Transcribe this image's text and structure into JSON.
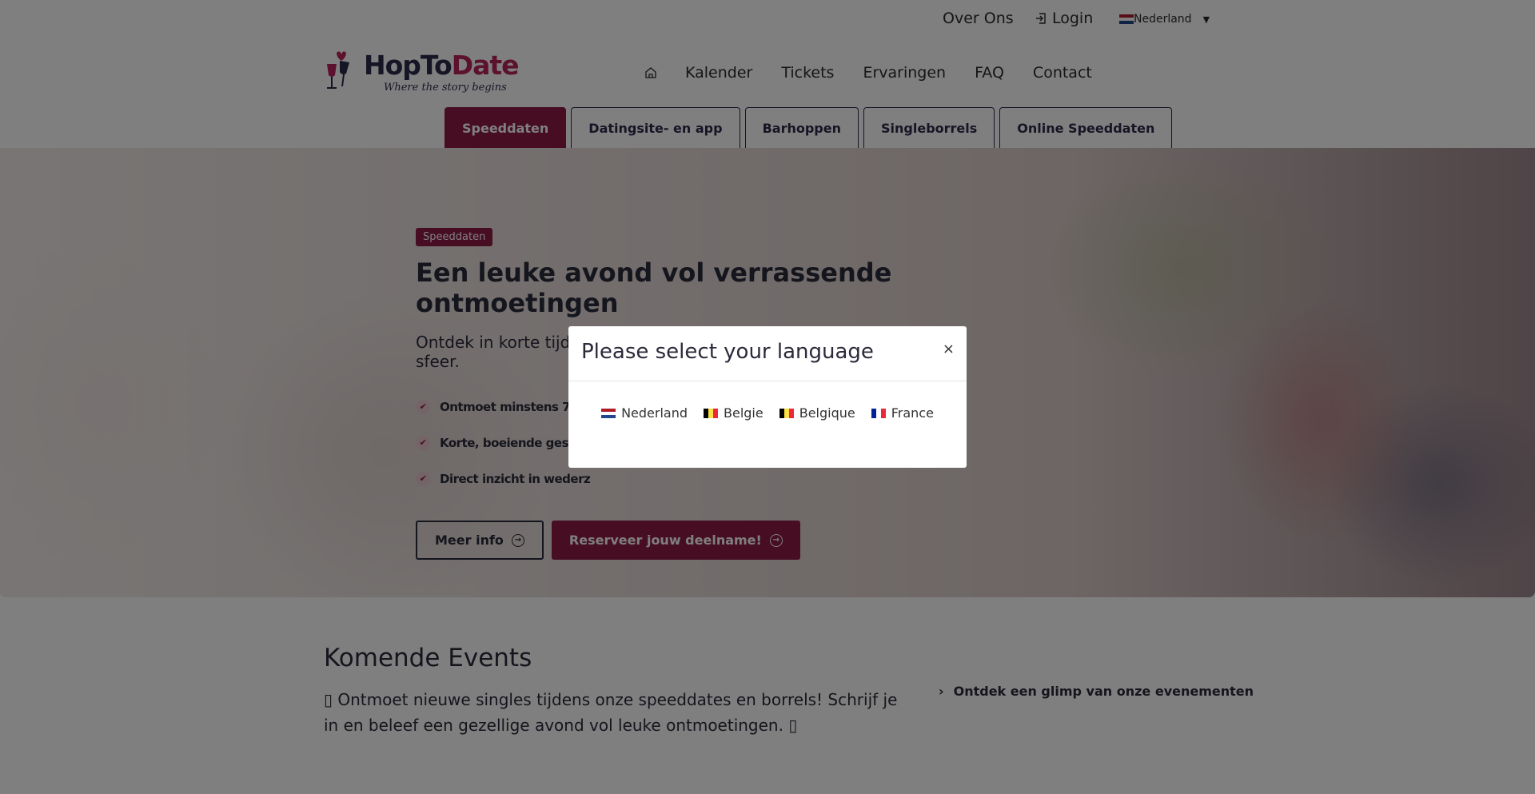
{
  "topbar": {
    "over_ons": "Over Ons",
    "login": "Login",
    "language": "Nederland"
  },
  "logo": {
    "brand_a": "HopTo",
    "brand_b": "Date",
    "tagline": "Where the story begins"
  },
  "nav": {
    "items": [
      "Kalender",
      "Tickets",
      "Ervaringen",
      "FAQ",
      "Contact"
    ]
  },
  "tabs": [
    "Speeddaten",
    "Datingsite- en app",
    "Barhoppen",
    "Singleborrels",
    "Online Speeddaten"
  ],
  "hero": {
    "badge": "Speeddaten",
    "title": "Een leuke avond vol verrassende ontmoetingen",
    "subtitle": "Ontdek in korte tijd wie bij jou past, in een ontspannen en gezellige sfeer.",
    "features": [
      "Ontmoet minstens 7 sin",
      "Korte, boeiende gespre",
      "Direct inzicht in wederz"
    ],
    "btn_info": "Meer info",
    "btn_reserve": "Reserveer jouw deelname!"
  },
  "events": {
    "title": "Komende Events",
    "description": "▯ Ontmoet nieuwe singles tijdens onze speeddates en borrels! Schrijf je in en beleef een gezellige avond vol leuke ontmoetingen. ▯",
    "glimpse": "Ontdek een glimp van onze evenementen"
  },
  "modal": {
    "title": "Please select your language",
    "close": "×",
    "languages": [
      {
        "label": "Nederland",
        "flag": "nl"
      },
      {
        "label": "Belgie",
        "flag": "be"
      },
      {
        "label": "Belgique",
        "flag": "be"
      },
      {
        "label": "France",
        "flag": "fr"
      }
    ]
  },
  "colors": {
    "accent": "#8e1b45",
    "navy": "#2d2a4a",
    "brand_pink": "#b8245a"
  }
}
